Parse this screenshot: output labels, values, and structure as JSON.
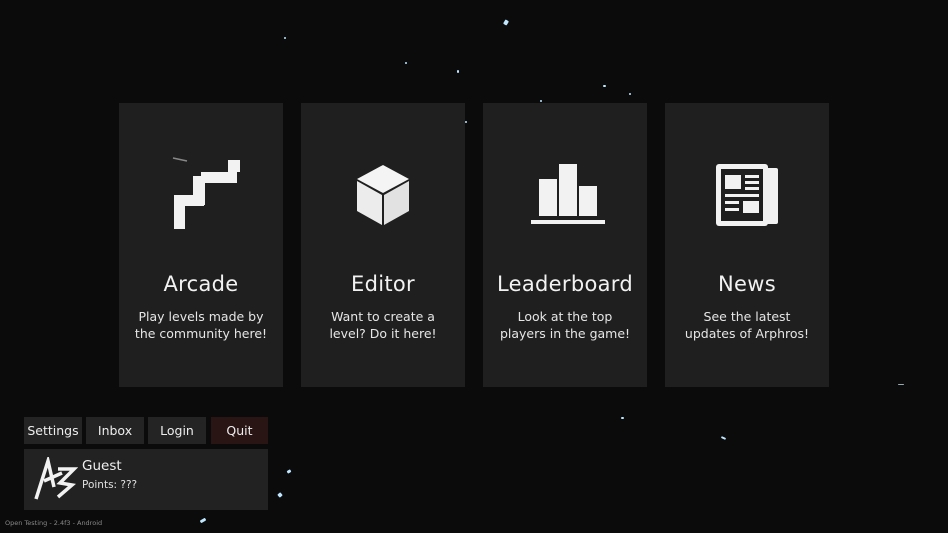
{
  "menu": [
    {
      "id": "arcade",
      "icon": "stairs-icon",
      "title": "Arcade",
      "desc_line1": "Play levels made by",
      "desc_line2": "the community here!"
    },
    {
      "id": "editor",
      "icon": "cube-icon",
      "title": "Editor",
      "desc_line1": "Want to create a",
      "desc_line2": "level? Do it here!"
    },
    {
      "id": "leaderboard",
      "icon": "bar-chart-icon",
      "title": "Leaderboard",
      "desc_line1": "Look at the top",
      "desc_line2": "players in the game!"
    },
    {
      "id": "news",
      "icon": "newspaper-icon",
      "title": "News",
      "desc_line1": "See the latest",
      "desc_line2": "updates of Arphros!"
    }
  ],
  "buttons": {
    "settings": "Settings",
    "inbox": "Inbox",
    "login": "Login",
    "quit": "Quit"
  },
  "profile": {
    "name": "Guest",
    "points": "Points: ???"
  },
  "footer": {
    "version": "Open Testing - 2.4f3 - Android"
  },
  "colors": {
    "background": "#0b0b0b",
    "card": "#1f1f1f",
    "button": "#242424",
    "quit_button": "#2a1515",
    "particle": "#bfe7ff"
  }
}
